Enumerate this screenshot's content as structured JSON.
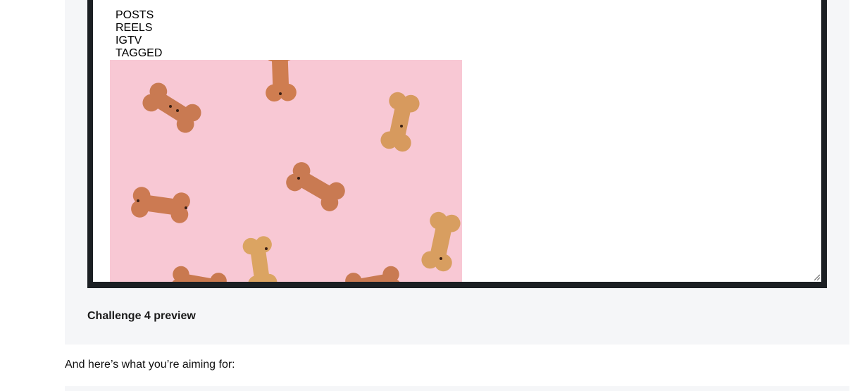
{
  "preview": {
    "tabs": [
      {
        "label": "POSTS"
      },
      {
        "label": "REELS"
      },
      {
        "label": "IGTV"
      },
      {
        "label": "TAGGED"
      }
    ],
    "image_subject": "dog biscuit bones on pink background"
  },
  "figure": {
    "caption": "Challenge 4 preview"
  },
  "article": {
    "paragraph": "And here’s what you’re aiming for:"
  },
  "colors": {
    "figure_background": "#f5f6f8",
    "frame_border": "#1b1f23",
    "image_background": "#f8c8d4",
    "biscuit": "#c97a52"
  }
}
